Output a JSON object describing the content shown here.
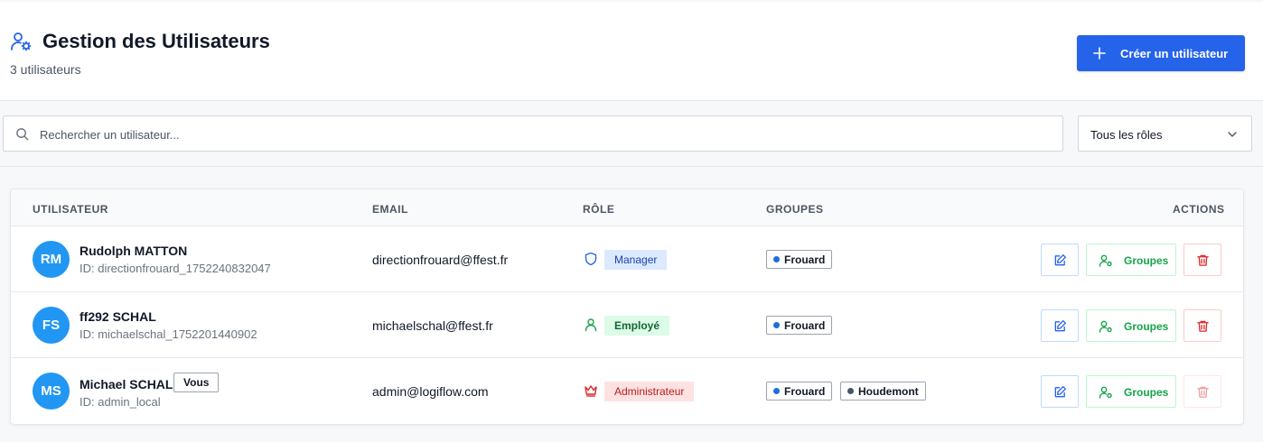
{
  "header": {
    "title": "Gestion des Utilisateurs",
    "subtitle": "3 utilisateurs",
    "create_label": "Créer un utilisateur",
    "title_icon": "user-cog-icon"
  },
  "filters": {
    "search_placeholder": "Rechercher un utilisateur...",
    "role_select_value": "Tous les rôles"
  },
  "table": {
    "columns": {
      "user": "UTILISATEUR",
      "email": "EMAIL",
      "role": "RÔLE",
      "groups": "GROUPES",
      "actions": "ACTIONS"
    },
    "groups_button_label": "Groupes",
    "rows": [
      {
        "initials": "RM",
        "name": "Rudolph MATTON",
        "id": "ID: directionfrouard_1752240832047",
        "email": "directionfrouard@ffest.fr",
        "role": "Manager",
        "role_icon": "shield-icon",
        "groups": [
          {
            "name": "Frouard",
            "color": "#1e6fd9"
          }
        ]
      },
      {
        "initials": "FS",
        "name": "ff292 SCHAL",
        "id": "ID: michaelschal_1752201440902",
        "email": "michaelschal@ffest.fr",
        "role": "Employé",
        "role_icon": "user-icon",
        "groups": [
          {
            "name": "Frouard",
            "color": "#1e6fd9"
          }
        ]
      },
      {
        "initials": "MS",
        "name": "Michael SCHAL",
        "badge": "Vous",
        "id": "ID: admin_local",
        "email": "admin@logiflow.com",
        "role": "Administrateur",
        "role_icon": "crown-icon",
        "groups": [
          {
            "name": "Frouard",
            "color": "#1e6fd9"
          },
          {
            "name": "Houdemont",
            "color": "#475569"
          }
        ]
      }
    ]
  },
  "colors": {
    "primary": "#2563eb",
    "avatar": "#2196f3",
    "success": "#16a34a",
    "danger": "#dc2626"
  }
}
